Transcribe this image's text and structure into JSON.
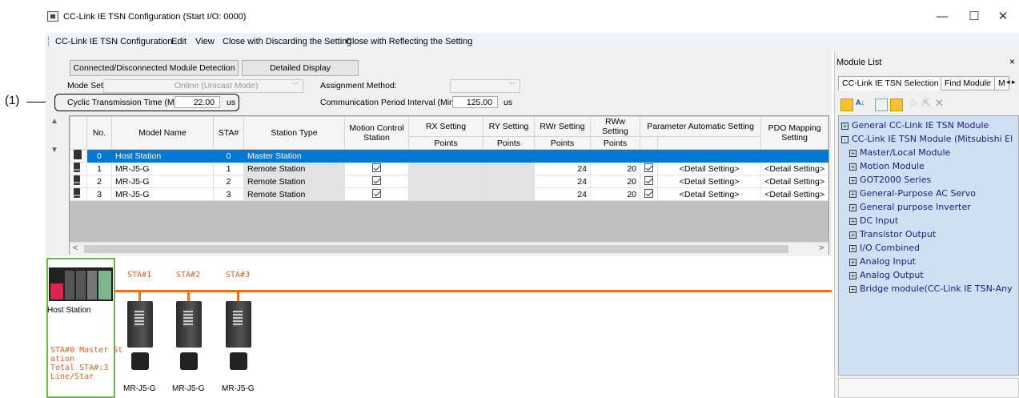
{
  "window": {
    "title": "CC-Link IE TSN Configuration (Start I/O: 0000)",
    "minimize": "—",
    "maximize": "☐",
    "close": "✕"
  },
  "annotation": {
    "callout_label": "(1)"
  },
  "menu": {
    "items": [
      "CC-Link IE TSN Configuration",
      "Edit",
      "View",
      "Close with Discarding the Setting",
      "Close with Reflecting the Setting"
    ]
  },
  "toolbar": {
    "detect_button": "Connected/Disconnected Module Detection",
    "detail_button": "Detailed Display"
  },
  "settings": {
    "mode_label": "Mode Setting:",
    "mode_value": "Online (Unicast Mode)",
    "assignment_label": "Assignment Method:",
    "assignment_value": "",
    "cyclic_label": "Cyclic Transmission Time (Min.):",
    "cyclic_value": "22.00",
    "cyclic_unit": "us",
    "comm_label": "Communication Period Interval (Min.):",
    "comm_value": "125.00",
    "comm_unit": "us"
  },
  "table": {
    "headers": [
      "No.",
      "Model Name",
      "STA#",
      "Station Type",
      "Motion Control Station",
      "RX Setting",
      "RY Setting",
      "RWr Setting",
      "RWw Setting",
      "Parameter Automatic Setting",
      "PDO Mapping Setting"
    ],
    "subheaders": [
      "Points",
      "Points",
      "Points",
      "Points"
    ],
    "rows": [
      {
        "no": "0",
        "model": "Host Station",
        "sta": "0",
        "type": "Master Station",
        "motion": false,
        "rwr": "",
        "rww": "",
        "param_check": false,
        "param": "",
        "pdo": ""
      },
      {
        "no": "1",
        "model": "MR-J5-G",
        "sta": "1",
        "type": "Remote Station",
        "motion": true,
        "rwr": "24",
        "rww": "20",
        "param_check": true,
        "param": "<Detail Setting>",
        "pdo": "<Detail Setting>"
      },
      {
        "no": "2",
        "model": "MR-J5-G",
        "sta": "2",
        "type": "Remote Station",
        "motion": true,
        "rwr": "24",
        "rww": "20",
        "param_check": true,
        "param": "<Detail Setting>",
        "pdo": "<Detail Setting>"
      },
      {
        "no": "3",
        "model": "MR-J5-G",
        "sta": "3",
        "type": "Remote Station",
        "motion": true,
        "rwr": "24",
        "rww": "20",
        "param_check": true,
        "param": "<Detail Setting>",
        "pdo": "<Detail Setting>"
      }
    ]
  },
  "network": {
    "host_label": "Host Station",
    "host_info": [
      "STA#0 Master St",
      "ation",
      "Total STA#:3",
      "Line/Star"
    ],
    "stations": [
      {
        "sta": "STA#1",
        "model": "MR-J5-G"
      },
      {
        "sta": "STA#2",
        "model": "MR-J5-G"
      },
      {
        "sta": "STA#3",
        "model": "MR-J5-G"
      }
    ],
    "colors": {
      "line": "#f07020",
      "host_border": "#66bb44",
      "selection": "#0078d7"
    }
  },
  "module_list": {
    "title": "Module List",
    "close": "×",
    "tabs": [
      "CC-Link IE TSN Selection",
      "Find Module",
      "M"
    ],
    "tree": [
      {
        "label": "General CC-Link IE TSN Module",
        "box": "+",
        "level": 0
      },
      {
        "label": "CC-Link IE TSN Module (Mitsubishi El",
        "box": "-",
        "level": 0
      },
      {
        "label": "Master/Local Module",
        "box": "+",
        "level": 1
      },
      {
        "label": "Motion Module",
        "box": "+",
        "level": 1
      },
      {
        "label": "GOT2000 Series",
        "box": "+",
        "level": 1
      },
      {
        "label": "General-Purpose AC Servo",
        "box": "+",
        "level": 1
      },
      {
        "label": "General purpose Inverter",
        "box": "+",
        "level": 1
      },
      {
        "label": "DC Input",
        "box": "+",
        "level": 1
      },
      {
        "label": "Transistor Output",
        "box": "+",
        "level": 1
      },
      {
        "label": "I/O Combined",
        "box": "+",
        "level": 1
      },
      {
        "label": "Analog Input",
        "box": "+",
        "level": 1
      },
      {
        "label": "Analog Output",
        "box": "+",
        "level": 1
      },
      {
        "label": "Bridge module(CC-Link IE TSN-Any",
        "box": "+",
        "level": 1
      }
    ]
  }
}
